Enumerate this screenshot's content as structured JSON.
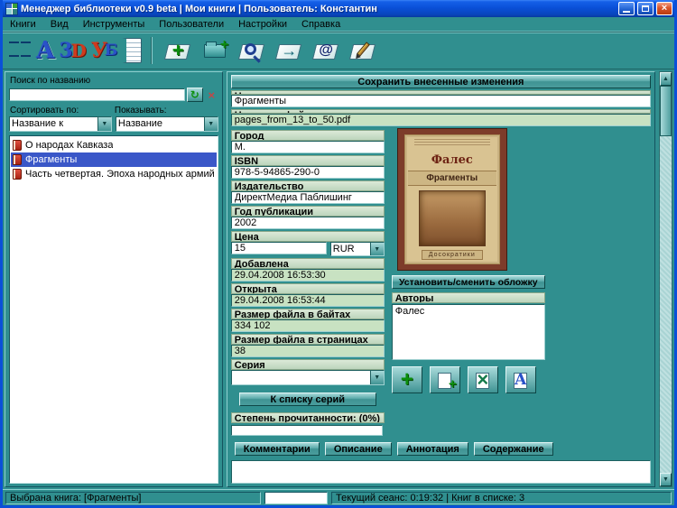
{
  "window": {
    "title": "Менеджер библиотеки v0.9 beta | Мои книги | Пользователь: Константин"
  },
  "icons": {
    "close": "×",
    "dropdown_arrow": "▼",
    "scroll_up": "▲",
    "scroll_down": "▼",
    "plus": "+",
    "cross": "×",
    "refresh": "↻",
    "at": "@",
    "arrow": "→",
    "letter_a": "A",
    "brand_a": "A",
    "brand_3": "3",
    "brand_d": "D",
    "brand_u": "У",
    "brand_b": "Б"
  },
  "menu": {
    "items": [
      {
        "label": "Книги"
      },
      {
        "label": "Вид"
      },
      {
        "label": "Инструменты"
      },
      {
        "label": "Пользователи"
      },
      {
        "label": "Настройки"
      },
      {
        "label": "Справка"
      }
    ]
  },
  "sidebar": {
    "search_label": "Поиск по названию",
    "search_value": "",
    "sort_label": "Сортировать по:",
    "show_label": "Показывать:",
    "sort_value": "Название к",
    "show_value": "Название",
    "books": [
      {
        "title": "О народах Кавказа"
      },
      {
        "title": "Фрагменты"
      },
      {
        "title": "Часть четвертая. Эпоха народных армий"
      }
    ]
  },
  "form": {
    "save_button": "Сохранить внесенные изменения",
    "title": {
      "label": "Название книги",
      "value": "Фрагменты"
    },
    "filename": {
      "label": "Название файла",
      "value": "pages_from_13_to_50.pdf"
    },
    "city": {
      "label": "Город",
      "value": "М."
    },
    "isbn": {
      "label": "ISBN",
      "value": "978-5-94865-290-0"
    },
    "publisher": {
      "label": "Издательство",
      "value": "ДиректМедиа Паблишинг"
    },
    "year": {
      "label": "Год публикации",
      "value": "2002"
    },
    "price": {
      "label": "Цена",
      "value": "15",
      "currency": "RUR"
    },
    "added": {
      "label": "Добавлена",
      "value": "29.04.2008 16:53:30"
    },
    "opened": {
      "label": "Открыта",
      "value": "29.04.2008 16:53:44"
    },
    "size_bytes": {
      "label": "Размер файла в байтах",
      "value": "334 102"
    },
    "size_pages": {
      "label": "Размер файла в страницах",
      "value": "38"
    },
    "series": {
      "label": "Серия",
      "value": "",
      "button": "К списку серий"
    },
    "progress": {
      "label": "Степень прочитанности: (0%)",
      "percent": 0
    },
    "tabs": [
      {
        "label": "Комментарии"
      },
      {
        "label": "Описание"
      },
      {
        "label": "Аннотация"
      },
      {
        "label": "Содержание"
      }
    ],
    "notes_value": ""
  },
  "cover_panel": {
    "cover": {
      "author": "Фалес",
      "title": "Фрагменты",
      "series": "Досократики"
    },
    "cover_button": "Установить/сменить обложку",
    "authors_label": "Авторы",
    "authors": [
      {
        "name": "Фалес"
      }
    ]
  },
  "statusbar": {
    "selected_book": "Выбрана книга: [Фрагменты]",
    "session": "Текущий сеанс: 0:19:32 | Книг в списке: 3"
  }
}
